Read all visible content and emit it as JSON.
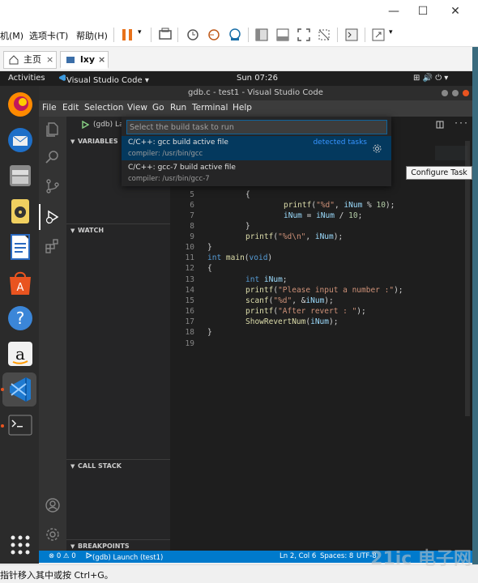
{
  "windows": {
    "menus": [
      "机(M)",
      "选项卡(T)",
      "帮助(H)"
    ],
    "tabs": [
      {
        "label": "主页"
      },
      {
        "label": "lxy"
      }
    ],
    "tab_close": "×",
    "hint": "指针移入其中或按 Ctrl+G。",
    "minimize": "—",
    "maximize": "☐",
    "close": "✕"
  },
  "ubuntu": {
    "activities": "Activities",
    "app_name": "Visual Studio Code ▾",
    "clock": "Sun 07:26",
    "tray": "⊞ 🔊 ⏻ ▾"
  },
  "vscode": {
    "title": "gdb.c - test1 - Visual Studio Code",
    "menu": [
      "File",
      "Edit",
      "Selection",
      "View",
      "Go",
      "Run",
      "Terminal",
      "Help"
    ],
    "debug_config": "(gdb) La",
    "sidebar": {
      "variables": "VARIABLES",
      "watch": "WATCH",
      "call_stack": "CALL STACK",
      "breakpoints": "BREAKPOINTS"
    },
    "quickpick": {
      "placeholder": "Select the build task to run",
      "items": [
        {
          "label": "C/C++: gcc build active file",
          "description": "compiler: /usr/bin/gcc",
          "tag": "detected tasks"
        },
        {
          "label": "C/C++: gcc-7 build active file",
          "description": "compiler: /usr/bin/gcc-7"
        }
      ]
    },
    "tooltip": "Configure Task",
    "line_numbers": [
      "5",
      "6",
      "7",
      "8",
      "9",
      "10",
      "11",
      "12",
      "13",
      "14",
      "15",
      "16",
      "17",
      "18",
      "19"
    ],
    "statusbar": {
      "problems": "⊗ 0 ⚠ 0",
      "launch": "(gdb) Launch (test1)",
      "position": "Ln 2, Col 6",
      "spaces": "Spaces: 8",
      "encoding": "UTF-8"
    }
  },
  "watermark": "21ic 电子网"
}
